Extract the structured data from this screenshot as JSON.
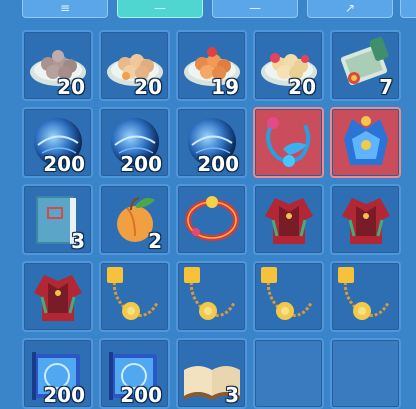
{
  "tabs": [
    {
      "glyph": "≡",
      "active": false
    },
    {
      "glyph": "—",
      "active": true
    },
    {
      "glyph": "—",
      "active": false
    },
    {
      "glyph": "↗",
      "active": false
    }
  ],
  "inventory": [
    {
      "item": "plate-of-sesame-dumplings",
      "qty": "20"
    },
    {
      "item": "plate-of-fried-pastries",
      "qty": "20"
    },
    {
      "item": "plate-of-orange-buns",
      "qty": "19"
    },
    {
      "item": "plate-of-rose-cakes",
      "qty": "20"
    },
    {
      "item": "treasure-scroll",
      "qty": "7"
    },
    {
      "item": "blue-spirit-orb",
      "qty": "200"
    },
    {
      "item": "blue-spirit-orb",
      "qty": "200"
    },
    {
      "item": "blue-spirit-orb",
      "qty": "200"
    },
    {
      "item": "azure-phoenix-necklace",
      "qty": ""
    },
    {
      "item": "azure-crown-armor",
      "qty": ""
    },
    {
      "item": "blue-skill-book",
      "qty": "3"
    },
    {
      "item": "golden-peach",
      "qty": "2"
    },
    {
      "item": "red-jade-bracelet",
      "qty": ""
    },
    {
      "item": "crimson-robe",
      "qty": ""
    },
    {
      "item": "crimson-robe",
      "qty": ""
    },
    {
      "item": "crimson-robe",
      "qty": ""
    },
    {
      "item": "rare-gold-necklace",
      "qty": ""
    },
    {
      "item": "rare-gold-necklace",
      "qty": ""
    },
    {
      "item": "rare-gold-necklace",
      "qty": ""
    },
    {
      "item": "rare-gold-necklace",
      "qty": ""
    },
    {
      "item": "magic-tome",
      "qty": "200"
    },
    {
      "item": "magic-tome",
      "qty": "200"
    },
    {
      "item": "open-book",
      "qty": "3"
    },
    {
      "item": "empty",
      "qty": ""
    },
    {
      "item": "empty",
      "qty": ""
    }
  ],
  "selected_slots": [
    8,
    9
  ],
  "colors": {
    "panel_bg": "#3a84c9",
    "slot_bg": "#2d6fb2",
    "slot_border": "#4f97dc",
    "selected_bg": "#c94d5b",
    "active_tab": "#4fd6d1"
  }
}
